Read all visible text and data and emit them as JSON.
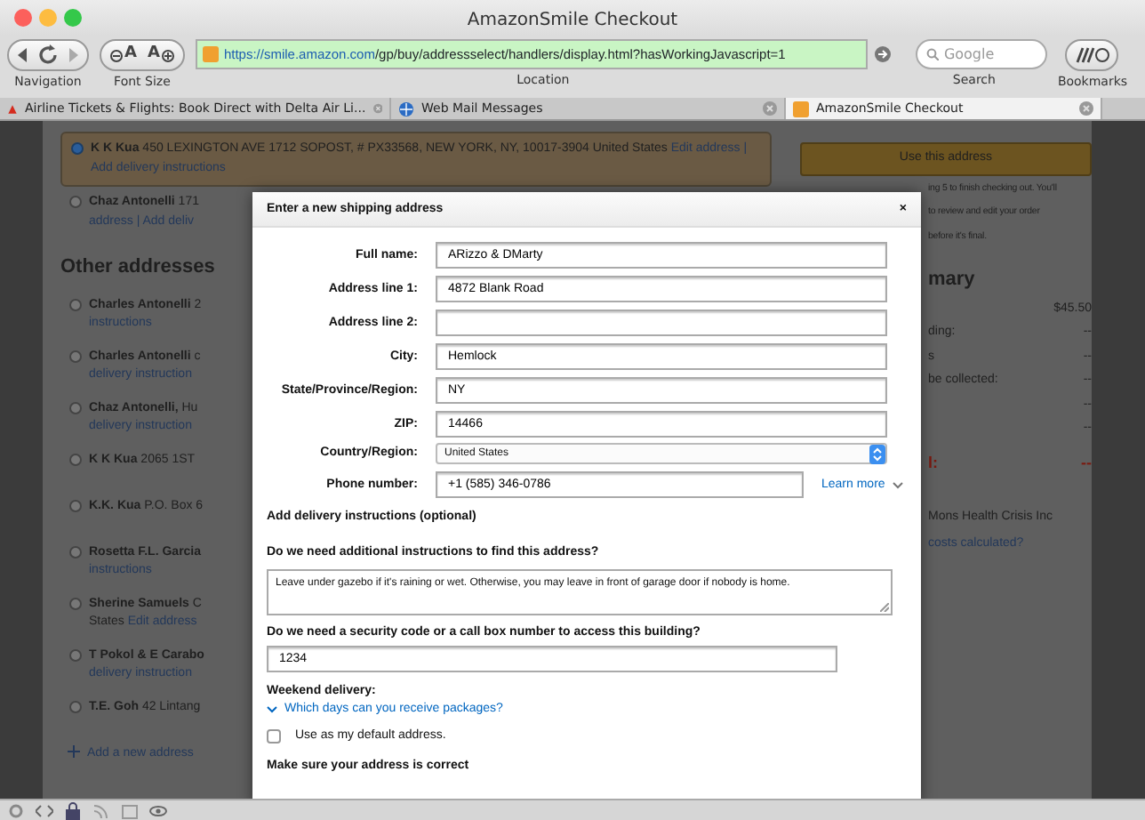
{
  "window": {
    "title": "AmazonSmile Checkout"
  },
  "toolbar": {
    "font_buttons": [
      "A",
      "A"
    ],
    "url_host": "https://smile.amazon.com",
    "url_path": "/gp/buy/addressselect/handlers/display.html?hasWorkingJavascript=1",
    "search_placeholder": "Google",
    "labels": [
      "Navigation",
      "Font Size",
      "Location",
      "Search",
      "Bookmarks"
    ]
  },
  "tabs": [
    {
      "label": "Airline Tickets & Flights: Book Direct with Delta Air Li...",
      "selected": false
    },
    {
      "label": "Web Mail Messages",
      "selected": false
    },
    {
      "label": "AmazonSmile Checkout",
      "selected": true
    }
  ],
  "current_addresses": [
    {
      "name": "K K Kua",
      "detail": "450 LEXINGTON AVE 1712 SOPOST, # PX33568, NEW YORK, NY, 10017-3904 United States",
      "link": "Edit address |",
      "note": "Add delivery instructions",
      "selected": true
    },
    {
      "name": "Chaz Antonelli",
      "detail": "171",
      "note": "address | Add deliv",
      "selected": false
    }
  ],
  "other_heading": "Other addresses",
  "other_addresses": [
    {
      "name": "Charles Antonelli",
      "detail": "2",
      "note": "instructions",
      "selected": false
    },
    {
      "name": "Charles Antonelli",
      "detail": "c",
      "note": "delivery instruction",
      "selected": false
    },
    {
      "name": "Chaz Antonelli,",
      "detail": "Hu",
      "note": "delivery instruction",
      "selected": false
    },
    {
      "name": "K K Kua",
      "detail": "2065 1ST",
      "selected": false
    },
    {
      "name": "K.K. Kua",
      "detail": "P.O. Box 6",
      "selected": false
    },
    {
      "name": "Rosetta F.L. Garcia",
      "note": "instructions",
      "selected": false
    },
    {
      "name": "Sherine Samuels",
      "detail": "C",
      "note_prefix": "States",
      "note": "Edit address",
      "selected": false
    },
    {
      "name": "T Pokol & E Carabo",
      "note": "delivery instruction",
      "selected": false
    },
    {
      "name": "T.E. Goh",
      "detail": "42 Lintang",
      "selected": false
    }
  ],
  "add_address": "Add a new address",
  "sidebar": {
    "button": "Use this address",
    "note_lines": [
      "ing 5 to finish checking out. You'll",
      "to review and edit your order",
      "before it's final."
    ],
    "heading": "mary",
    "rows": [
      {
        "value": "$45.50"
      },
      {
        "label": "ding:",
        "value": "--"
      },
      {
        "label": "s",
        "value": "--"
      },
      {
        "label": "be collected:",
        "value": "--"
      },
      {
        "value": "--"
      },
      {
        "value": "--"
      }
    ],
    "total": {
      "label": "l:",
      "value": "--"
    },
    "charity": "Mons Health Crisis Inc",
    "link": "costs calculated?"
  },
  "modal": {
    "title": "Enter a new shipping address",
    "close": "×",
    "fields": [
      {
        "label": "Full name:",
        "value": "ARizzo & DMarty",
        "kind": "text"
      },
      {
        "label": "Address line 1:",
        "value": "4872 Blank Road",
        "kind": "text"
      },
      {
        "label": "Address line 2:",
        "kind": "text"
      },
      {
        "label": "City:",
        "value": "Hemlock",
        "kind": "text"
      },
      {
        "label": "State/Province/Region:",
        "value": "NY",
        "kind": "text"
      },
      {
        "label": "ZIP:",
        "value": "14466",
        "kind": "text"
      },
      {
        "label": "Country/Region:",
        "value": "United States",
        "kind": "select"
      },
      {
        "label": "Phone number:",
        "value": "+1 (585) 346-0786",
        "kind": "phone",
        "link": "Learn more"
      }
    ],
    "instructions_heading": "Add delivery instructions (optional)",
    "find_question": "Do we need additional instructions to find this address?",
    "find_answer": "Leave under gazebo if it's raining or wet. Otherwise, you may leave in front of garage door if nobody is home.",
    "code_question": "Do we need a security code or a call box number to access this building?",
    "code_answer": "1234",
    "weekend_heading": "Weekend delivery:",
    "weekend_link": "Which days can you receive packages?",
    "default_label": "Use as my default address.",
    "default_checked": false,
    "confirm_heading": "Make sure your address is correct"
  }
}
